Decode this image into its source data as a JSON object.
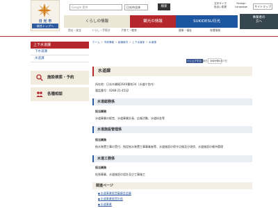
{
  "logo": {
    "city_name": "日 光 市",
    "subtitle": "総合トップへ"
  },
  "topbar": {
    "search_placeholder": "Google 提供",
    "search_scope": "日光市全体",
    "search_button": "検索",
    "text_size_label": "文字サイズ\n色合い変更",
    "language_label": "Foreign\nLanguage",
    "sitemap_label": "サイトマップ"
  },
  "nav": {
    "kurashi": "くらしの情報",
    "kanko": "観光の情報",
    "sukidesu": "SUKIDESU日光",
    "jigyosha": "事業者の\n方へ"
  },
  "subnav": {
    "items": [
      "防災・安全",
      "くらし・手続き",
      "子育て・教育",
      "健康・福祉",
      "各種情報"
    ]
  },
  "sidebar": {
    "header": "上下水道課",
    "items": [
      "下水道課",
      "水道課"
    ],
    "boxes": [
      {
        "label": "施設検索・予約",
        "icon": "search-icon"
      },
      {
        "label": "各種相談",
        "icon": "people-icon"
      }
    ]
  },
  "breadcrumb": {
    "items": [
      "ホーム",
      "市政情報",
      "組織案内",
      "上下水道部",
      "水道課"
    ]
  },
  "share": {
    "facebook": "f シェアする",
    "twitter": "ツイート"
  },
  "update": "更新日：2021年5月7日",
  "page_title": "水道課",
  "info": {
    "location": "所在地：日光市瀬尾2640番地34（水道庁舎内）",
    "phone": "電話番号：0288-21-4532"
  },
  "sections": [
    {
      "title": "水道総務係",
      "sub": "担当業務",
      "text": "水道事業の経営、水道事業計画、広報活動、水道料金等"
    },
    {
      "title": "水道施設管理係",
      "sub": "担当業務",
      "text": "給水装置工事の受付、指定給水装置工事事業者等、水道施設の保守点検及び改良、水道施設の維持管理"
    },
    {
      "title": "水道工務係",
      "sub": "担当業務",
      "text": "拡張事業、水道施設の設計及び工事施工"
    }
  ],
  "related": {
    "title": "関連ページ",
    "links": [
      "水道事業経営審議会会議",
      "水道事業経営計画",
      "水道事業"
    ]
  },
  "colors": {
    "accent_red": "#b3272d",
    "accent_blue": "#1c56a1",
    "beige": "#ece6d7"
  }
}
